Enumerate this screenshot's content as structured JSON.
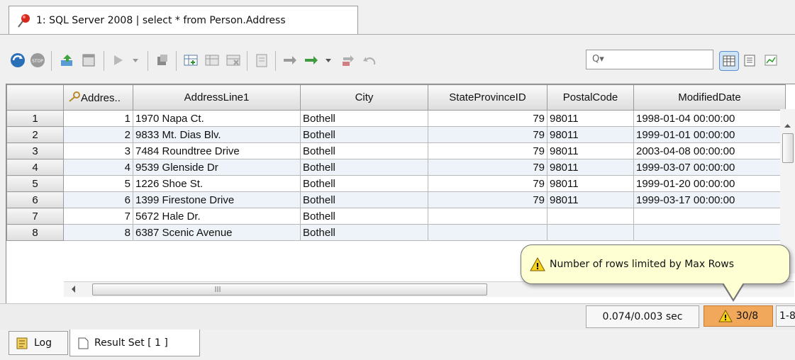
{
  "tab": {
    "title": "1: SQL Server 2008 | select * from Person.Address"
  },
  "search": {
    "placeholder": "Q▾"
  },
  "grid": {
    "columns": [
      "Addres..",
      "AddressLine1",
      "City",
      "StateProvinceID",
      "PostalCode",
      "ModifiedDate"
    ],
    "rows": [
      {
        "rn": "1",
        "id": "1",
        "addr": "1970 Napa Ct.",
        "city": "Bothell",
        "state": "79",
        "postal": "98011",
        "mod": "1998-01-04 00:00:00"
      },
      {
        "rn": "2",
        "id": "2",
        "addr": "9833 Mt. Dias Blv.",
        "city": "Bothell",
        "state": "79",
        "postal": "98011",
        "mod": "1999-01-01 00:00:00"
      },
      {
        "rn": "3",
        "id": "3",
        "addr": "7484 Roundtree Drive",
        "city": "Bothell",
        "state": "79",
        "postal": "98011",
        "mod": "2003-04-08 00:00:00"
      },
      {
        "rn": "4",
        "id": "4",
        "addr": "9539 Glenside Dr",
        "city": "Bothell",
        "state": "79",
        "postal": "98011",
        "mod": "1999-03-07 00:00:00"
      },
      {
        "rn": "5",
        "id": "5",
        "addr": "1226 Shoe St.",
        "city": "Bothell",
        "state": "79",
        "postal": "98011",
        "mod": "1999-01-20 00:00:00"
      },
      {
        "rn": "6",
        "id": "6",
        "addr": "1399 Firestone Drive",
        "city": "Bothell",
        "state": "79",
        "postal": "98011",
        "mod": "1999-03-17 00:00:00"
      },
      {
        "rn": "7",
        "id": "7",
        "addr": "5672 Hale Dr.",
        "city": "Bothell",
        "state": "",
        "postal": "",
        "mod": ""
      },
      {
        "rn": "8",
        "id": "8",
        "addr": "6387 Scenic Avenue",
        "city": "Bothell",
        "state": "",
        "postal": "",
        "mod": ""
      }
    ]
  },
  "status": {
    "timing": "0.074/0.003 sec",
    "rows_warning": "30/8",
    "range": "1-8"
  },
  "tooltip": {
    "text": "Number of rows limited by Max Rows"
  },
  "bottom_tabs": {
    "log": "Log",
    "result": "Result Set [ 1 ]"
  },
  "colors": {
    "warning_bg": "#f1a85b",
    "tooltip_bg": "#ffffd4",
    "alt_row": "#eef3f9"
  }
}
